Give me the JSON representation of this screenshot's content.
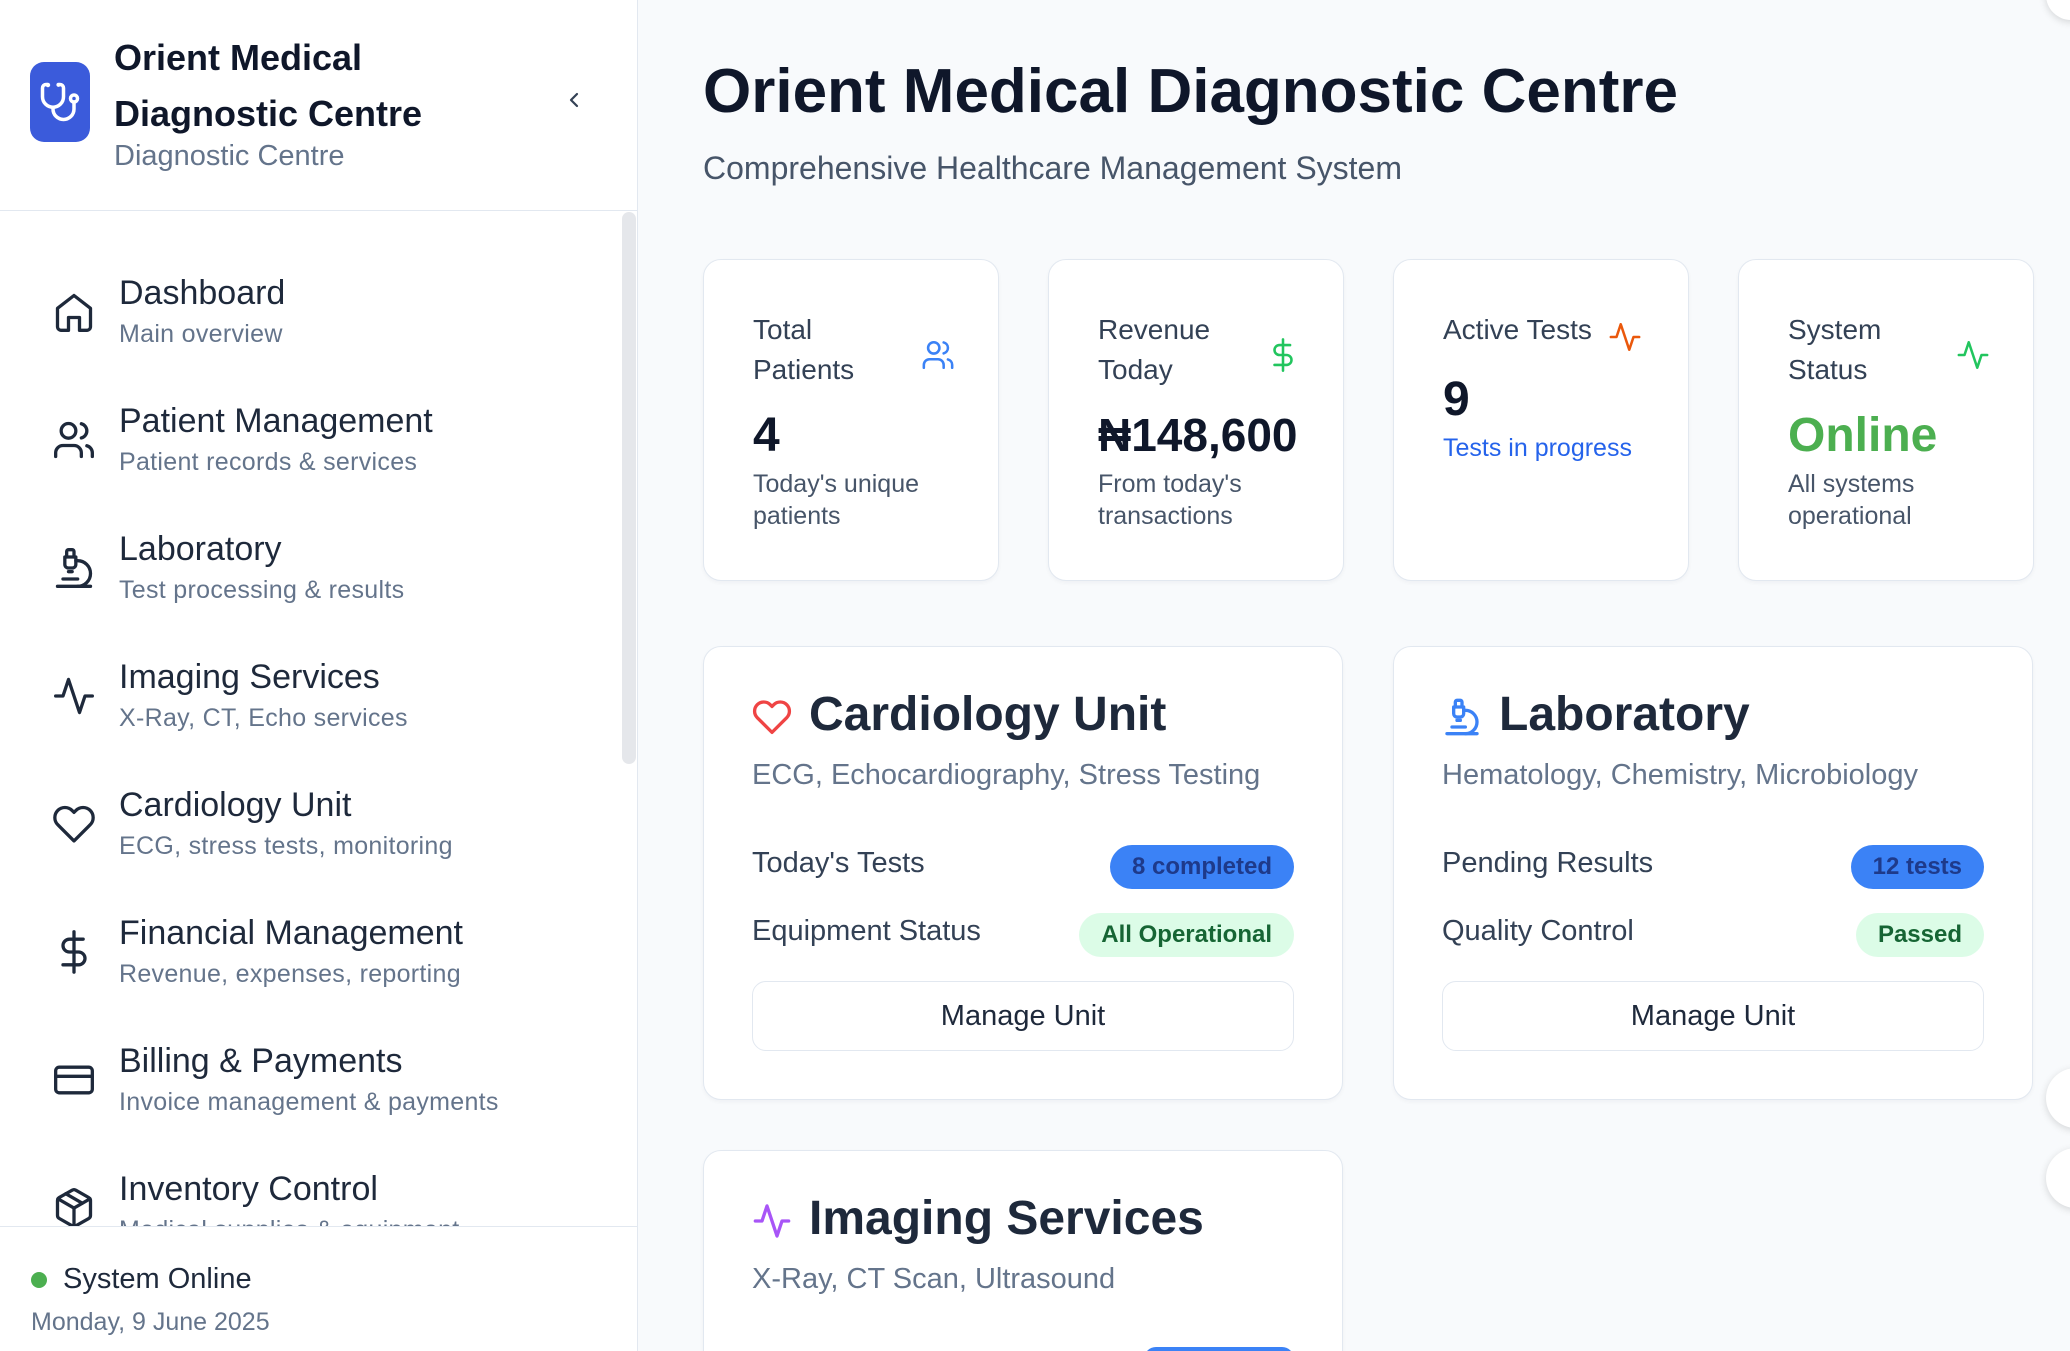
{
  "brand": {
    "name": "Orient Medical Diagnostic Centre",
    "subtitle": "Diagnostic Centre"
  },
  "sidebar": {
    "items": [
      {
        "title": "Dashboard",
        "desc": "Main overview",
        "icon": "home-icon"
      },
      {
        "title": "Patient Management",
        "desc": "Patient records & services",
        "icon": "users-icon"
      },
      {
        "title": "Laboratory",
        "desc": "Test processing & results",
        "icon": "microscope-icon"
      },
      {
        "title": "Imaging Services",
        "desc": "X-Ray, CT, Echo services",
        "icon": "activity-icon"
      },
      {
        "title": "Cardiology Unit",
        "desc": "ECG, stress tests, monitoring",
        "icon": "heart-icon"
      },
      {
        "title": "Financial Management",
        "desc": "Revenue, expenses, reporting",
        "icon": "dollar-icon"
      },
      {
        "title": "Billing & Payments",
        "desc": "Invoice management & payments",
        "icon": "credit-card-icon"
      },
      {
        "title": "Inventory Control",
        "desc": "Medical supplies & equipment",
        "icon": "package-icon"
      }
    ],
    "footer": {
      "status": "System Online",
      "date": "Monday, 9 June 2025"
    }
  },
  "main": {
    "title": "Orient Medical Diagnostic Centre",
    "subtitle": "Comprehensive Healthcare Management System",
    "stats": [
      {
        "label": "Total Patients",
        "value": "4",
        "foot": "Today's unique patients",
        "icon": "users-icon",
        "color": "#3b82f6"
      },
      {
        "label": "Revenue Today",
        "value": "₦148,600",
        "foot": "From today's transactions",
        "icon": "dollar-icon",
        "color": "#22c55e"
      },
      {
        "label": "Active Tests",
        "value": "9",
        "foot": "Tests in progress",
        "icon": "activity-icon",
        "color": "#ea580c"
      },
      {
        "label": "System Status",
        "value": "Online",
        "foot": "All systems operational",
        "icon": "activity-icon",
        "color": "#22c55e"
      }
    ],
    "units": [
      {
        "title": "Cardiology Unit",
        "subtitle": "ECG, Echocardiography, Stress Testing",
        "icon": "heart-icon",
        "icon_color": "#ef4444",
        "rows": [
          {
            "label": "Today's Tests",
            "badge": "8 completed",
            "style": "blue"
          },
          {
            "label": "Equipment Status",
            "badge": "All Operational",
            "style": "green"
          }
        ],
        "button": "Manage Unit"
      },
      {
        "title": "Laboratory",
        "subtitle": "Hematology, Chemistry, Microbiology",
        "icon": "microscope-icon",
        "icon_color": "#3b82f6",
        "rows": [
          {
            "label": "Pending Results",
            "badge": "12 tests",
            "style": "blue"
          },
          {
            "label": "Quality Control",
            "badge": "Passed",
            "style": "green"
          }
        ],
        "button": "Manage Unit"
      },
      {
        "title": "Imaging Services",
        "subtitle": "X-Ray, CT Scan, Ultrasound",
        "icon": "activity-icon",
        "icon_color": "#a855f7"
      }
    ]
  },
  "colors": {
    "brand": "#3b5bdb",
    "online": "#4caf50",
    "revenue_accent": "#22c55e",
    "active_tests_accent": "#ea580c",
    "in_progress_text": "#2563eb"
  }
}
